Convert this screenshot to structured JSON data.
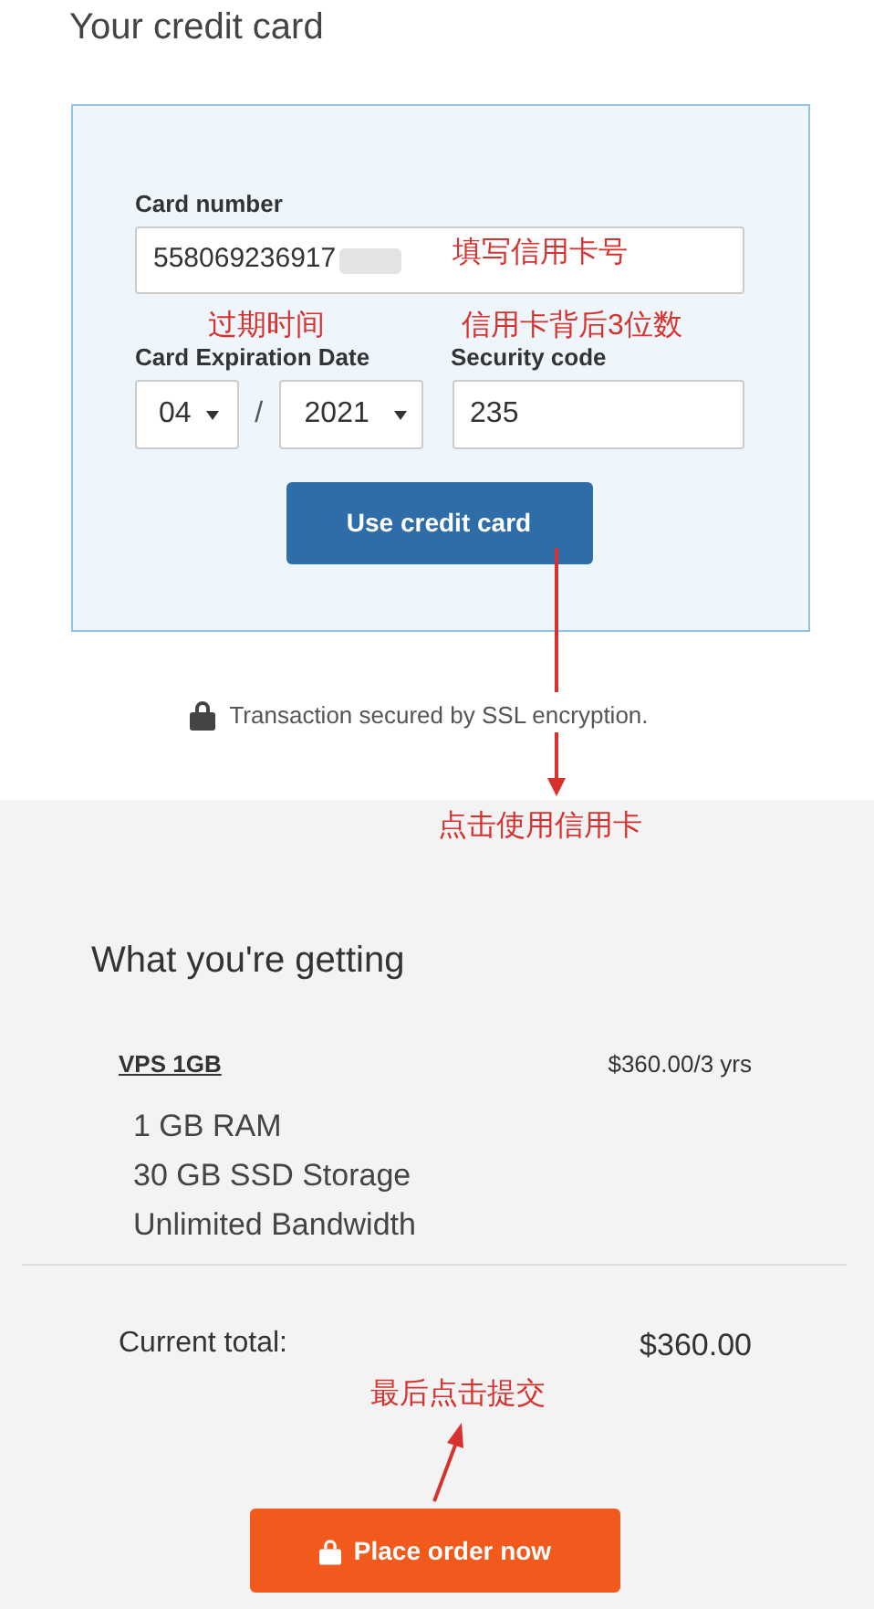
{
  "page_title": "Your credit card",
  "card_form": {
    "card_number": {
      "label": "Card number",
      "value": "558069236917"
    },
    "expiration": {
      "label": "Card Expiration Date",
      "month": "04",
      "separator": "/",
      "year": "2021"
    },
    "security_code": {
      "label": "Security code",
      "value": "235"
    },
    "submit_button": "Use credit card"
  },
  "security_note": "Transaction secured by SSL encryption.",
  "order": {
    "title": "What you're getting",
    "product": {
      "name": "VPS 1GB",
      "price": "$360.00/3 yrs",
      "features": [
        "1 GB RAM",
        "30 GB SSD Storage",
        "Unlimited Bandwidth"
      ]
    },
    "total": {
      "label": "Current total:",
      "value": "$360.00"
    },
    "button": "Place order now"
  },
  "annotations": [
    {
      "text": "填写信用卡号"
    },
    {
      "text": "过期时间"
    },
    {
      "text": "信用卡背后3位数"
    },
    {
      "text": "点击使用信用卡"
    },
    {
      "text": "最后点击提交"
    }
  ]
}
